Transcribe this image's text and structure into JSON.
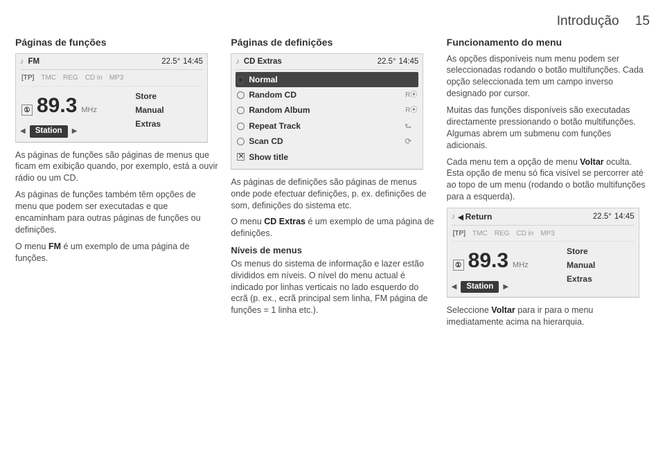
{
  "header": {
    "title": "Introdução",
    "page": "15"
  },
  "col1": {
    "title": "Páginas de funções",
    "ui": {
      "band": "FM",
      "temp": "22.5°",
      "time": "14:45",
      "statusTP": "[TP]",
      "statusTMC": "TMC",
      "statusREG": "REG",
      "statusCDin": "CD in",
      "statusMP3": "MP3",
      "preset": "①",
      "freq": "89.3",
      "unit": "MHz",
      "stationLabel": "Station",
      "menuStore": "Store",
      "menuManual": "Manual",
      "menuExtras": "Extras"
    },
    "p1": "As páginas de funções são páginas de menus que ficam em exibição quando, por exemplo, está a ouvir rádio ou um CD.",
    "p2": "As páginas de funções também têm opções de menu que podem ser executadas e que encaminham para outras páginas de funções ou definições.",
    "p3a": "O menu ",
    "p3b": "FM",
    "p3c": " é um exemplo de uma página de funções."
  },
  "col2": {
    "title": "Páginas de definições",
    "ui": {
      "band": "CD Extras",
      "temp": "22.5°",
      "time": "14:45",
      "rows": {
        "normal": "Normal",
        "randomCD": "Random CD",
        "randomAlbum": "Random Album",
        "repeatTrack": "Repeat Track",
        "scanCD": "Scan CD",
        "showTitle": "Show title",
        "ro": "R⦿"
      }
    },
    "p1": "As páginas de definições são páginas de menus onde pode efectuar definições, p. ex. definições de som, definições do sistema etc.",
    "p2a": "O menu ",
    "p2b": "CD Extras",
    "p2c": " é um exemplo de uma página de definições.",
    "sub": "Níveis de menus",
    "p3": "Os menus do sistema de informação e lazer estão divididos em níveis. O nível do menu actual é indicado por linhas verticais no lado esquerdo do ecrã (p. ex., ecrã principal sem linha, FM página de funções = 1 linha etc.)."
  },
  "col3": {
    "title": "Funcionamento do menu",
    "p1": "As opções disponíveis num menu podem ser seleccionadas rodando o botão multifunções. Cada opção seleccionada tem um campo inverso designado por cursor.",
    "p2": "Muitas das funções disponíveis são executadas directamente pressionando o botão multifunções. Algumas abrem um submenu com funções adicionais.",
    "p3a": "Cada menu tem a opção de menu ",
    "p3b": "Voltar",
    "p3c": " oculta. Esta opção de menu só fica visível se percorrer até ao topo de um menu (rodando o botão multifunções para a esquerda).",
    "ui": {
      "back": "Return",
      "temp": "22.5°",
      "time": "14:45",
      "statusTP": "[TP]",
      "statusTMC": "TMC",
      "statusREG": "REG",
      "statusCDin": "CD in",
      "statusMP3": "MP3",
      "preset": "①",
      "freq": "89.3",
      "unit": "MHz",
      "stationLabel": "Station",
      "menuStore": "Store",
      "menuManual": "Manual",
      "menuExtras": "Extras"
    },
    "p4a": "Seleccione ",
    "p4b": "Voltar",
    "p4c": " para ir para o menu imediatamente acima na hierarquia."
  }
}
